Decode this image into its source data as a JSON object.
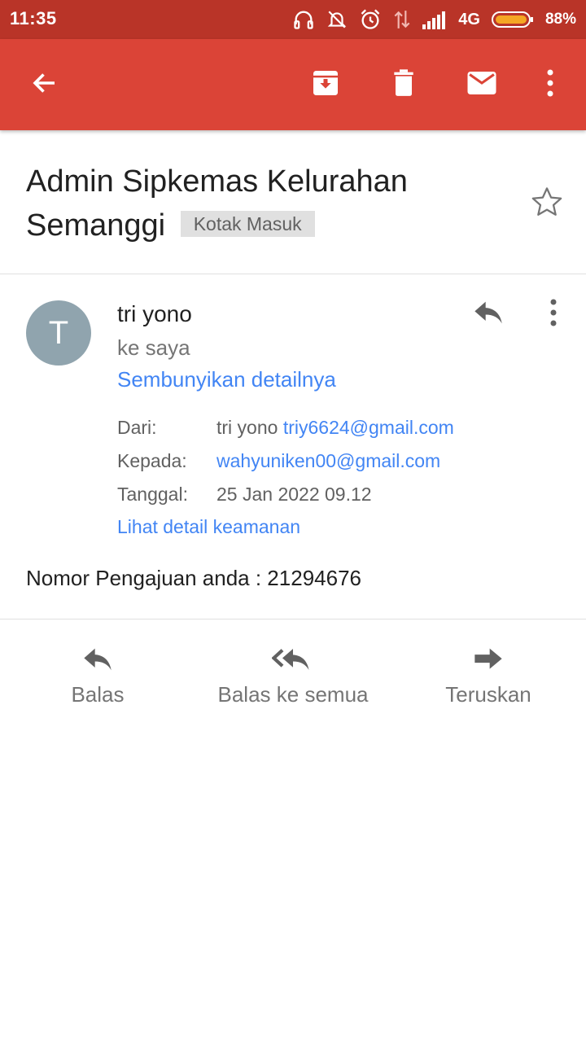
{
  "status_bar": {
    "time": "11:35",
    "network": "4G",
    "battery": "88%",
    "icons": [
      "headphones-icon",
      "notifications-off-icon",
      "alarm-icon",
      "data-transfer-icon",
      "signal-icon",
      "battery-icon"
    ],
    "background": "#b93428"
  },
  "app_bar": {
    "background": "#db4437",
    "icons": [
      "back-arrow-icon",
      "archive-icon",
      "delete-icon",
      "mail-icon",
      "more-vert-icon"
    ]
  },
  "email": {
    "subject": "Admin Sipkemas Kelurahan Semanggi",
    "label": "Kotak Masuk",
    "sender_initial": "T",
    "sender_name": "tri yono",
    "to_me": "ke saya",
    "hide_details": "Sembunyikan detailnya",
    "details": {
      "from_label": "Dari:",
      "from_name": "tri yono",
      "from_email": "triy6624@gmail.com",
      "to_label": "Kepada:",
      "to_email": "wahyuniken00@gmail.com",
      "date_label": "Tanggal:",
      "date_value": "25 Jan 2022 09.12"
    },
    "security_link": "Lihat detail keamanan",
    "body": "Nomor Pengajuan anda : 21294676"
  },
  "actions": {
    "reply": "Balas",
    "reply_all": "Balas ke semua",
    "forward": "Teruskan"
  },
  "colors": {
    "link": "#4285f4",
    "avatar": "#90a4ae"
  }
}
